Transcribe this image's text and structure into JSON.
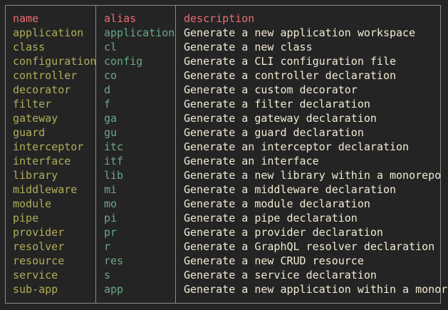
{
  "colors": {
    "background": "#242424",
    "border": "#8a8a8a",
    "header": "#ec6d71",
    "name": "#b0ae5a",
    "alias": "#6aa884",
    "description": "#f2ead4"
  },
  "table": {
    "headers": {
      "name": "name",
      "alias": "alias",
      "description": "description"
    },
    "rows": [
      {
        "name": "application",
        "alias": "application",
        "description": "Generate a new application workspace"
      },
      {
        "name": "class",
        "alias": "cl",
        "description": "Generate a new class"
      },
      {
        "name": "configuration",
        "alias": "config",
        "description": "Generate a CLI configuration file"
      },
      {
        "name": "controller",
        "alias": "co",
        "description": "Generate a controller declaration"
      },
      {
        "name": "decorator",
        "alias": "d",
        "description": "Generate a custom decorator"
      },
      {
        "name": "filter",
        "alias": "f",
        "description": "Generate a filter declaration"
      },
      {
        "name": "gateway",
        "alias": "ga",
        "description": "Generate a gateway declaration"
      },
      {
        "name": "guard",
        "alias": "gu",
        "description": "Generate a guard declaration"
      },
      {
        "name": "interceptor",
        "alias": "itc",
        "description": "Generate an interceptor declaration"
      },
      {
        "name": "interface",
        "alias": "itf",
        "description": "Generate an interface"
      },
      {
        "name": "library",
        "alias": "lib",
        "description": "Generate a new library within a monorepo"
      },
      {
        "name": "middleware",
        "alias": "mi",
        "description": "Generate a middleware declaration"
      },
      {
        "name": "module",
        "alias": "mo",
        "description": "Generate a module declaration"
      },
      {
        "name": "pipe",
        "alias": "pi",
        "description": "Generate a pipe declaration"
      },
      {
        "name": "provider",
        "alias": "pr",
        "description": "Generate a provider declaration"
      },
      {
        "name": "resolver",
        "alias": "r",
        "description": "Generate a GraphQL resolver declaration"
      },
      {
        "name": "resource",
        "alias": "res",
        "description": "Generate a new CRUD resource"
      },
      {
        "name": "service",
        "alias": "s",
        "description": "Generate a service declaration"
      },
      {
        "name": "sub-app",
        "alias": "app",
        "description": "Generate a new application within a monorepo"
      }
    ]
  }
}
